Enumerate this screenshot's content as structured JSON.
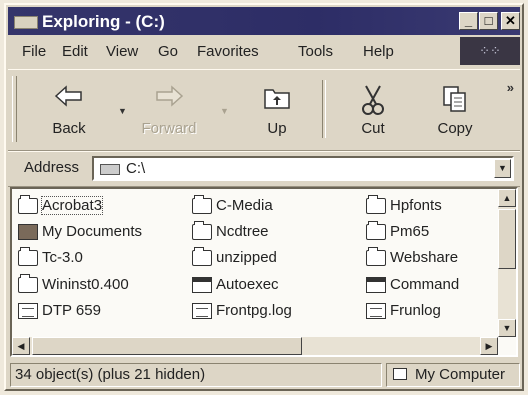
{
  "window": {
    "title": "Exploring -  (C:)",
    "controls": {
      "minimize": "_",
      "maximize": "□",
      "close": "✕"
    }
  },
  "menu": [
    {
      "label": "File"
    },
    {
      "label": "Edit"
    },
    {
      "label": "View"
    },
    {
      "label": "Go"
    },
    {
      "label": "Favorites"
    },
    {
      "label": "Tools"
    },
    {
      "label": "Help"
    }
  ],
  "toolbar": {
    "back": "Back",
    "forward": "Forward",
    "up": "Up",
    "cut": "Cut",
    "copy": "Copy",
    "more": "»"
  },
  "address": {
    "label": "Address",
    "value": "C:\\"
  },
  "files": [
    {
      "name": "Acrobat3",
      "icon": "folder-icon",
      "selected": true
    },
    {
      "name": "My Documents",
      "icon": "my-documents-icon"
    },
    {
      "name": "Tc-3.0",
      "icon": "folder-icon"
    },
    {
      "name": "Wininst0.400",
      "icon": "folder-icon"
    },
    {
      "name": "DTP 659",
      "icon": "document-icon"
    },
    {
      "name": "C-Media",
      "icon": "folder-icon"
    },
    {
      "name": "Ncdtree",
      "icon": "folder-icon"
    },
    {
      "name": "unzipped",
      "icon": "folder-icon"
    },
    {
      "name": "Autoexec",
      "icon": "batch-file-icon"
    },
    {
      "name": "Frontpg.log",
      "icon": "document-icon"
    },
    {
      "name": "Hpfonts",
      "icon": "folder-icon"
    },
    {
      "name": "Pm65",
      "icon": "folder-icon"
    },
    {
      "name": "Webshare",
      "icon": "folder-icon"
    },
    {
      "name": "Command",
      "icon": "msdos-program-icon"
    },
    {
      "name": "Frunlog",
      "icon": "document-icon"
    }
  ],
  "status": {
    "objects": "34 object(s) (plus 21 hidden)",
    "location": "My Computer"
  }
}
